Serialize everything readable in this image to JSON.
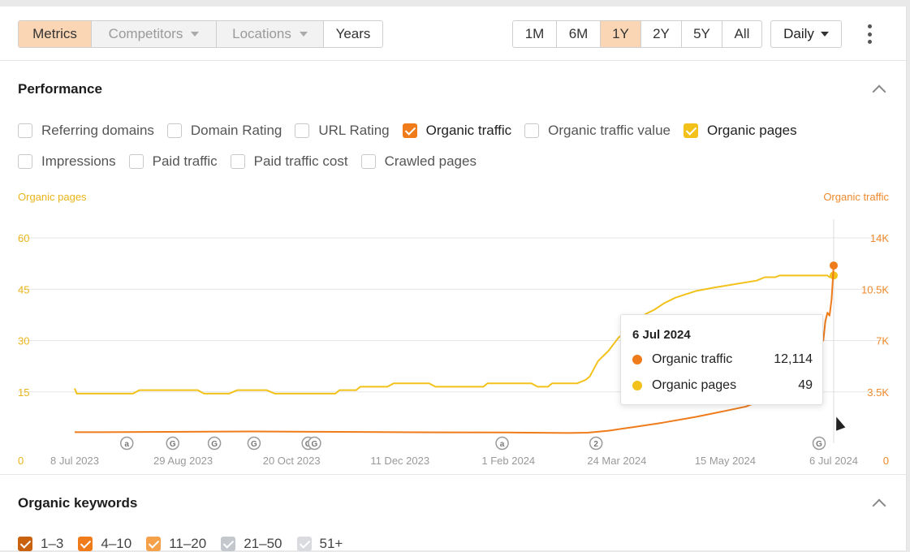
{
  "toolbar": {
    "left_tabs": [
      {
        "label": "Metrics",
        "state": "active"
      },
      {
        "label": "Competitors",
        "state": "disabled"
      },
      {
        "label": "Locations",
        "state": "disabled"
      },
      {
        "label": "Years",
        "state": "normal"
      }
    ],
    "ranges": [
      {
        "label": "1M",
        "active": false
      },
      {
        "label": "6M",
        "active": false
      },
      {
        "label": "1Y",
        "active": true
      },
      {
        "label": "2Y",
        "active": false
      },
      {
        "label": "5Y",
        "active": false
      },
      {
        "label": "All",
        "active": false
      }
    ],
    "interval": "Daily",
    "more_icon": "kebab-menu-icon"
  },
  "performance": {
    "title": "Performance",
    "collapse_icon": "chevron-up-icon",
    "metrics": [
      {
        "label": "Referring domains",
        "checked": false,
        "color": ""
      },
      {
        "label": "Domain Rating",
        "checked": false,
        "color": ""
      },
      {
        "label": "URL Rating",
        "checked": false,
        "color": ""
      },
      {
        "label": "Organic traffic",
        "checked": true,
        "color": "#ef7b1a"
      },
      {
        "label": "Organic traffic value",
        "checked": false,
        "color": ""
      },
      {
        "label": "Organic pages",
        "checked": true,
        "color": "#f2c21b"
      },
      {
        "label": "Impressions",
        "checked": false,
        "color": ""
      },
      {
        "label": "Paid traffic",
        "checked": false,
        "color": ""
      },
      {
        "label": "Paid traffic cost",
        "checked": false,
        "color": ""
      },
      {
        "label": "Crawled pages",
        "checked": false,
        "color": ""
      }
    ]
  },
  "chart_data": {
    "type": "line",
    "left_axis_label": "Organic pages",
    "right_axis_label": "Organic traffic",
    "left_ticks": [
      "60",
      "45",
      "30",
      "15",
      "0"
    ],
    "left_ylim": [
      0,
      60
    ],
    "right_ticks": [
      "14K",
      "10.5K",
      "7K",
      "3.5K",
      "0"
    ],
    "right_ylim": [
      0,
      14000
    ],
    "x_ticks": [
      "8 Jul 2023",
      "29 Aug 2023",
      "20 Oct 2023",
      "11 Dec 2023",
      "1 Feb 2024",
      "24 Mar 2024",
      "15 May 2024",
      "6 Jul 2024"
    ],
    "grid": true,
    "series": [
      {
        "name": "Organic pages",
        "axis": "left",
        "color": "#f2c21b",
        "points": [
          [
            "2023-07-08",
            16
          ],
          [
            "2023-07-09",
            14.5
          ],
          [
            "2023-08-05",
            14.5
          ],
          [
            "2023-08-08",
            15.5
          ],
          [
            "2023-09-05",
            15.5
          ],
          [
            "2023-09-08",
            14.5
          ],
          [
            "2023-09-20",
            14.5
          ],
          [
            "2023-09-24",
            15.5
          ],
          [
            "2023-10-08",
            15.5
          ],
          [
            "2023-10-12",
            14.5
          ],
          [
            "2023-11-10",
            14.5
          ],
          [
            "2023-11-12",
            15.5
          ],
          [
            "2023-11-20",
            15.5
          ],
          [
            "2023-11-22",
            16.5
          ],
          [
            "2023-12-05",
            16.5
          ],
          [
            "2023-12-08",
            17.5
          ],
          [
            "2023-12-25",
            17.5
          ],
          [
            "2023-12-28",
            16.5
          ],
          [
            "2024-01-20",
            16.5
          ],
          [
            "2024-01-22",
            17.5
          ],
          [
            "2024-02-12",
            17.5
          ],
          [
            "2024-02-15",
            16.5
          ],
          [
            "2024-02-20",
            16.5
          ],
          [
            "2024-02-22",
            17.5
          ],
          [
            "2024-03-05",
            17.5
          ],
          [
            "2024-03-09",
            18.5
          ],
          [
            "2024-03-11",
            19.5
          ],
          [
            "2024-03-15",
            24
          ],
          [
            "2024-03-20",
            27
          ],
          [
            "2024-03-25",
            31
          ],
          [
            "2024-03-30",
            33
          ],
          [
            "2024-04-01",
            36
          ],
          [
            "2024-04-06",
            37.5
          ],
          [
            "2024-04-11",
            39
          ],
          [
            "2024-04-16",
            41
          ],
          [
            "2024-04-21",
            42.5
          ],
          [
            "2024-04-26",
            43.5
          ],
          [
            "2024-05-01",
            44.5
          ],
          [
            "2024-05-10",
            45.5
          ],
          [
            "2024-05-20",
            46.5
          ],
          [
            "2024-05-30",
            47.5
          ],
          [
            "2024-06-03",
            48.5
          ],
          [
            "2024-06-08",
            48.5
          ],
          [
            "2024-06-10",
            49
          ],
          [
            "2024-07-03",
            49
          ],
          [
            "2024-07-04",
            48.5
          ],
          [
            "2024-07-06",
            49
          ]
        ]
      },
      {
        "name": "Organic traffic",
        "axis": "right",
        "color": "#ef7b1a",
        "points": [
          [
            "2023-07-08",
            750
          ],
          [
            "2023-08-01",
            760
          ],
          [
            "2023-09-01",
            780
          ],
          [
            "2023-10-01",
            800
          ],
          [
            "2023-11-01",
            780
          ],
          [
            "2023-12-01",
            760
          ],
          [
            "2024-01-01",
            740
          ],
          [
            "2024-02-01",
            730
          ],
          [
            "2024-03-01",
            700
          ],
          [
            "2024-03-10",
            720
          ],
          [
            "2024-03-20",
            850
          ],
          [
            "2024-04-01",
            1100
          ],
          [
            "2024-04-15",
            1400
          ],
          [
            "2024-05-01",
            1800
          ],
          [
            "2024-05-15",
            2200
          ],
          [
            "2024-05-25",
            2500
          ],
          [
            "2024-06-01",
            2900
          ],
          [
            "2024-06-05",
            3300
          ],
          [
            "2024-06-10",
            5600
          ],
          [
            "2024-06-13",
            5800
          ],
          [
            "2024-06-18",
            5700
          ],
          [
            "2024-06-22",
            6300
          ],
          [
            "2024-06-26",
            7900
          ],
          [
            "2024-06-27",
            8200
          ],
          [
            "2024-06-28",
            7600
          ],
          [
            "2024-06-29",
            8700
          ],
          [
            "2024-06-30",
            7900
          ],
          [
            "2024-07-01",
            7000
          ],
          [
            "2024-07-02",
            8300
          ],
          [
            "2024-07-03",
            8900
          ],
          [
            "2024-07-04",
            8700
          ],
          [
            "2024-07-05",
            9800
          ],
          [
            "2024-07-06",
            12114
          ]
        ]
      }
    ],
    "annotations": [
      {
        "date": "2023-08-02",
        "label": "a"
      },
      {
        "date": "2023-08-24",
        "label": "G"
      },
      {
        "date": "2023-09-13",
        "label": "G"
      },
      {
        "date": "2023-10-02",
        "label": "G"
      },
      {
        "date": "2023-10-28",
        "label": "G"
      },
      {
        "date": "2023-10-31",
        "label": "G"
      },
      {
        "date": "2024-01-29",
        "label": "a"
      },
      {
        "date": "2024-03-14",
        "label": "2"
      },
      {
        "date": "2024-06-29",
        "label": "G"
      }
    ],
    "hover": {
      "date": "6 Jul 2024",
      "rows": [
        {
          "label": "Organic traffic",
          "value": "12,114",
          "color": "#ef7b1a"
        },
        {
          "label": "Organic pages",
          "value": "49",
          "color": "#f2c21b"
        }
      ]
    }
  },
  "organic_keywords": {
    "title": "Organic keywords",
    "ranges": [
      {
        "label": "1–3",
        "checked": true,
        "color": "#c9620f"
      },
      {
        "label": "4–10",
        "checked": true,
        "color": "#ef7b1a"
      },
      {
        "label": "11–20",
        "checked": true,
        "color": "#f4a14a"
      },
      {
        "label": "21–50",
        "checked": true,
        "color": "#c4c7cc"
      },
      {
        "label": "51+",
        "checked": true,
        "color": "#d9dbde"
      }
    ]
  }
}
